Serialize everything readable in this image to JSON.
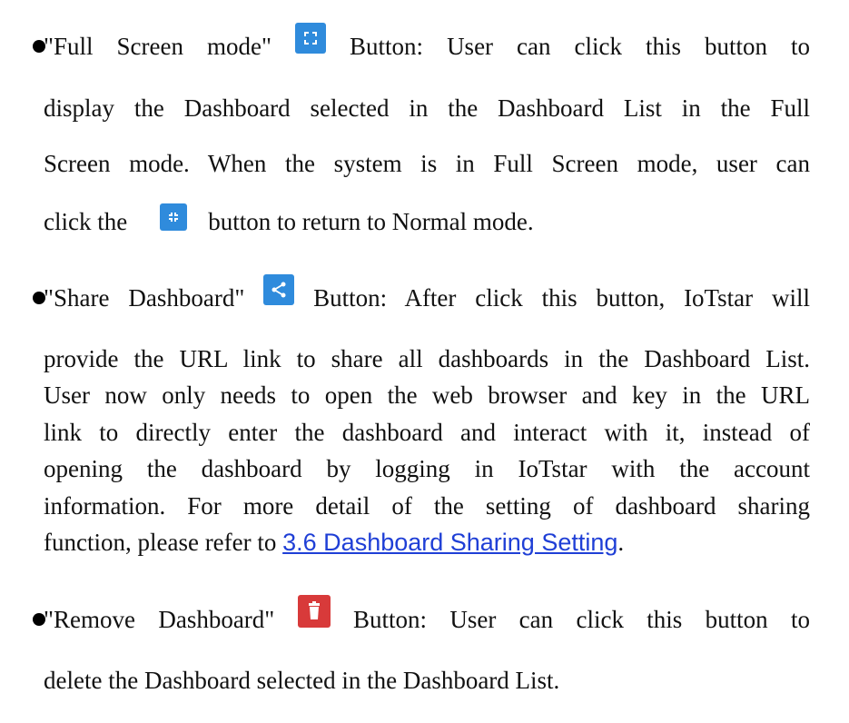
{
  "items": [
    {
      "title": "\"Full Screen mode\"",
      "icon": "fullscreen-icon",
      "line1_rest": "Button: User can click this button to",
      "line2": "display the Dashboard selected in the Dashboard List in the Full",
      "line3": "Screen mode. When the system is in Full Screen mode, user can",
      "line4_before": "click the",
      "line4_icon": "exit-fullscreen-icon",
      "line4_after": "button to return to Normal mode."
    },
    {
      "title": "\"Share Dashboard\"",
      "icon": "share-icon",
      "line1_rest": "Button: After click this button, IoTstar will",
      "line2": "provide the URL link to share all dashboards in the Dashboard List.",
      "line3": "User now only needs to open the web browser and key in the URL",
      "line4": "link to directly enter the dashboard and interact with it, instead of",
      "line5": "opening the dashboard by logging in IoTstar with the account",
      "line6": "information. For more detail of the setting of dashboard sharing",
      "line7_before": "function, please refer to",
      "link": "3.6 Dashboard Sharing Setting",
      "line7_after": "."
    },
    {
      "title": "\"Remove Dashboard\"",
      "icon": "trash-icon",
      "line1_rest": "Button: User can click this button to",
      "line2": "delete the Dashboard selected in the Dashboard List."
    }
  ],
  "colors": {
    "icon_blue": "#2f8bdc",
    "icon_red": "#d83a3a",
    "link": "#1f3fd6"
  }
}
